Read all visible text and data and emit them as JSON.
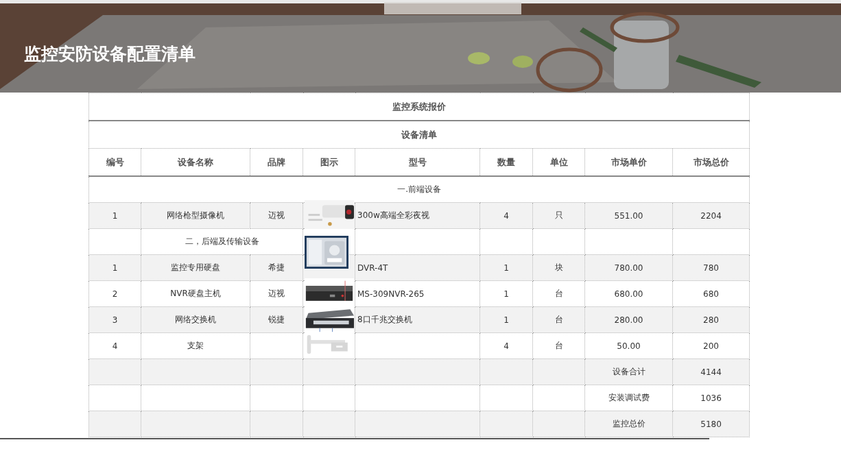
{
  "banner": {
    "title": "监控安防设备配置清单"
  },
  "table": {
    "title": "监控系统报价",
    "subtitle": "设备清单",
    "columns": [
      "编号",
      "设备名称",
      "品牌",
      "图示",
      "型号",
      "数量",
      "单位",
      "市场单价",
      "市场总价"
    ],
    "rows": [
      {
        "kind": "section",
        "heading": "一.前端设备"
      },
      {
        "kind": "item",
        "no": "1",
        "name": "网络枪型摄像机",
        "brand": "迈视",
        "model": "300w高端全彩夜视",
        "qty": "4",
        "unit": "只",
        "price": "551.00",
        "total": "2204"
      },
      {
        "kind": "subsection",
        "group": "二，后端及传输设备"
      },
      {
        "kind": "item",
        "no": "1",
        "name": "监控专用硬盘",
        "brand": "希捷",
        "model": "DVR-4T",
        "qty": "1",
        "unit": "块",
        "price": "780.00",
        "total": "780"
      },
      {
        "kind": "item",
        "no": "2",
        "name": "NVR硬盘主机",
        "brand": "迈视",
        "model": "MS-309NVR-265",
        "qty": "1",
        "unit": "台",
        "price": "680.00",
        "total": "680"
      },
      {
        "kind": "item",
        "no": "3",
        "name": "网络交换机",
        "brand": "锐捷",
        "model": "8口千兆交换机",
        "qty": "1",
        "unit": "台",
        "price": "280.00",
        "total": "280"
      },
      {
        "kind": "item",
        "no": "4",
        "name": "支架",
        "qty": "4",
        "unit": "台",
        "price": "50.00",
        "total": "200"
      },
      {
        "kind": "summary",
        "label": "设备合计",
        "value": "4144"
      },
      {
        "kind": "summary",
        "label": "安装调试费",
        "value": "1036"
      },
      {
        "kind": "summary",
        "label": "监控总价",
        "value": "5180"
      }
    ]
  }
}
